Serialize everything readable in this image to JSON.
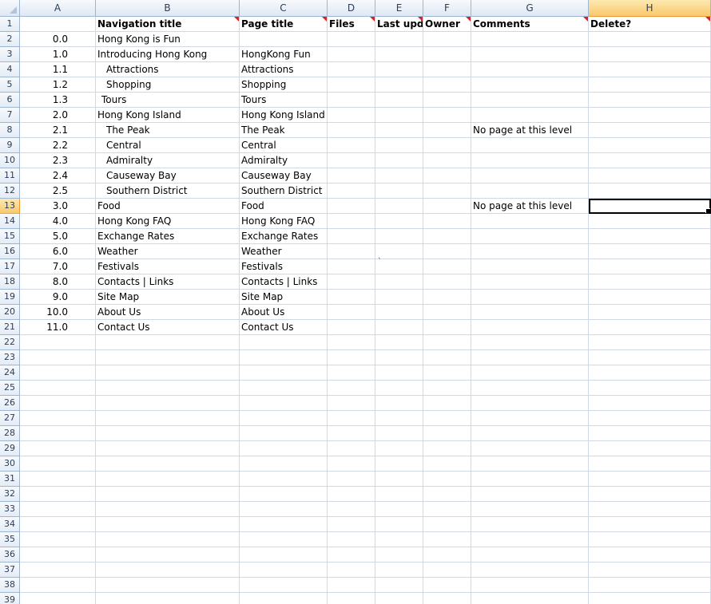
{
  "columns": [
    "A",
    "B",
    "C",
    "D",
    "E",
    "F",
    "G",
    "H"
  ],
  "active_column": "H",
  "active_row": 13,
  "header_row": {
    "a": "",
    "b": "Navigation title",
    "c": "Page title",
    "d": "Files",
    "e": "Last upda",
    "f": "Owner",
    "g": "Comments",
    "h": "Delete?"
  },
  "rows": [
    {
      "a": "0.0",
      "b": "Hong Kong is Fun",
      "c": "",
      "g": ""
    },
    {
      "a": "1.0",
      "b": "Introducing Hong Kong",
      "c": "HongKong Fun",
      "g": ""
    },
    {
      "a": "1.1",
      "b": "Attractions",
      "c": "Attractions",
      "g": ""
    },
    {
      "a": "1.2",
      "b": "Shopping",
      "c": "Shopping",
      "g": ""
    },
    {
      "a": "1.3",
      "b": "Tours",
      "c": "Tours",
      "g": ""
    },
    {
      "a": "2.0",
      "b": "Hong Kong Island",
      "c": "Hong Kong Island",
      "g": ""
    },
    {
      "a": "2.1",
      "b": "The Peak",
      "c": "The Peak",
      "g": "No page at this level"
    },
    {
      "a": "2.2",
      "b": "Central",
      "c": "Central",
      "g": ""
    },
    {
      "a": "2.3",
      "b": "Admiralty",
      "c": "Admiralty",
      "g": ""
    },
    {
      "a": "2.4",
      "b": "Causeway Bay",
      "c": "Causeway Bay",
      "g": ""
    },
    {
      "a": "2.5",
      "b": "Southern District",
      "c": "Southern District",
      "g": ""
    },
    {
      "a": "3.0",
      "b": "Food",
      "c": "Food",
      "g": "No page at this level"
    },
    {
      "a": "4.0",
      "b": "Hong Kong FAQ",
      "c": "Hong Kong FAQ",
      "g": ""
    },
    {
      "a": "5.0",
      "b": "Exchange Rates",
      "c": "Exchange Rates",
      "g": ""
    },
    {
      "a": "6.0",
      "b": "Weather",
      "c": "Weather",
      "g": ""
    },
    {
      "a": "7.0",
      "b": "Festivals",
      "c": "Festivals",
      "g": ""
    },
    {
      "a": "8.0",
      "b": "Contacts | Links",
      "c": "Contacts | Links",
      "g": ""
    },
    {
      "a": "9.0",
      "b": "Site Map",
      "c": "Site Map",
      "g": ""
    },
    {
      "a": "10.0",
      "b": "About Us",
      "c": "About Us",
      "g": ""
    },
    {
      "a": "11.0",
      "b": "Contact Us",
      "c": "Contact Us",
      "g": ""
    }
  ],
  "total_rows": 39,
  "stray_mark": "`"
}
